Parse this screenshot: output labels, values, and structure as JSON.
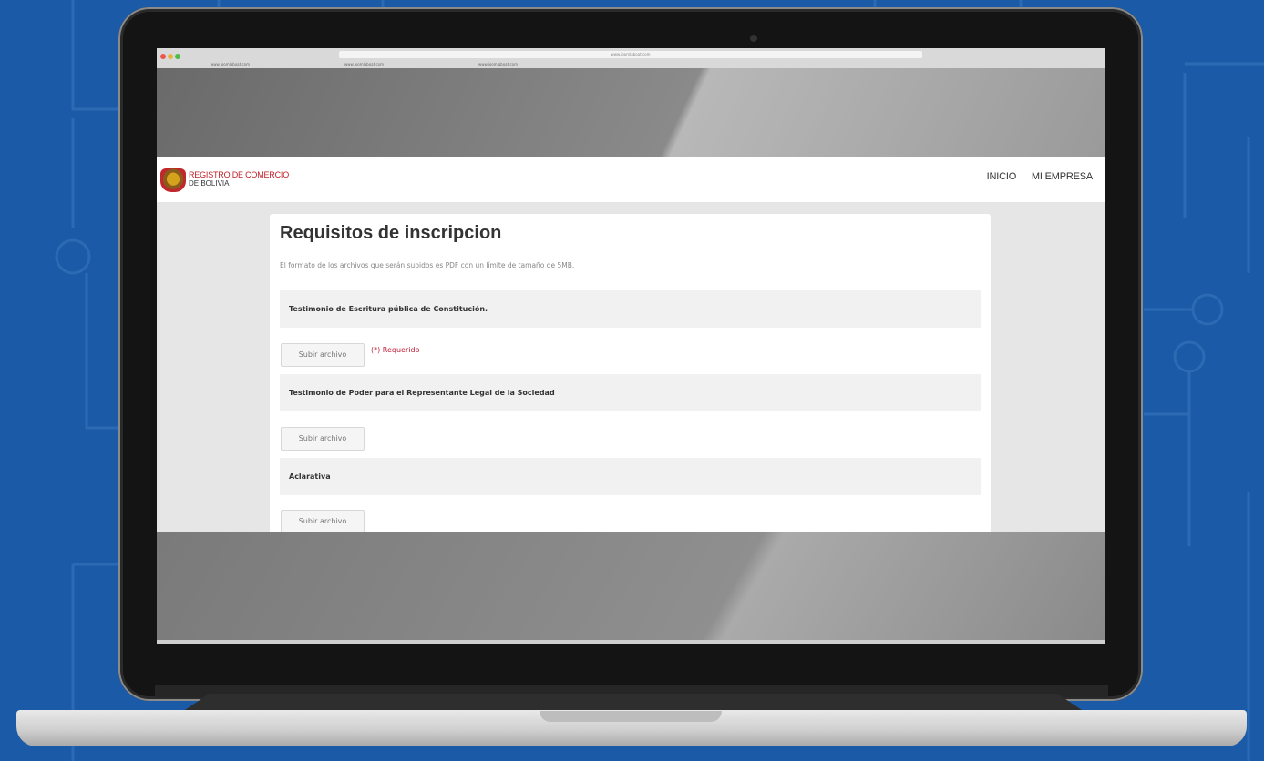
{
  "browser": {
    "url": "www.joomlaboat.com",
    "tabs": [
      "www.joomlaboat.com",
      "www.joomlaboat.com",
      "www.joomlaboat.com"
    ]
  },
  "site": {
    "brand_line1": "REGISTRO DE COMERCIO",
    "brand_line2": "DE BOLIVIA",
    "nav": [
      "INICIO",
      "MI EMPRESA"
    ]
  },
  "page": {
    "title": "Requisitos de inscripcion",
    "intro": "El formato de los archivos que serán subidos es PDF con un límite de tamaño de 5MB.",
    "requirements": [
      {
        "label": "Testimonio de Escritura pública de Constitución.",
        "button": "Subir archivo",
        "required": "(*) Requerido"
      },
      {
        "label": "Testimonio de Poder para el Representante Legal de la Sociedad",
        "button": "Subir archivo"
      },
      {
        "label": "Aclarativa",
        "button": "Subir archivo"
      }
    ]
  },
  "colors": {
    "background": "#1a5aa6",
    "brand_red": "#c0202a",
    "required_red": "#c0203c"
  }
}
